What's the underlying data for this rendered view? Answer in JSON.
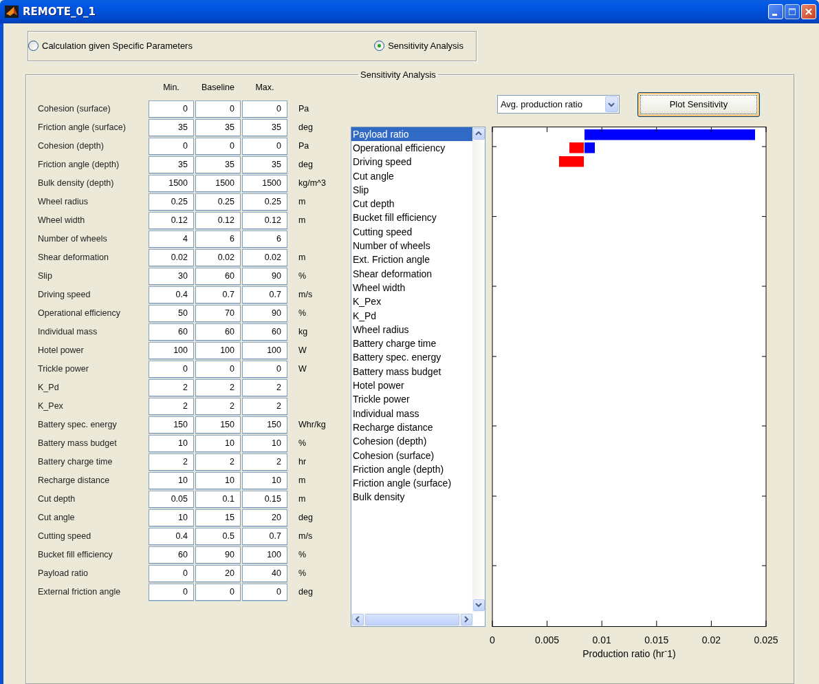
{
  "window": {
    "title": "REMOTE_0_1"
  },
  "mode_options": [
    {
      "label": "Calculation given Specific Parameters",
      "selected": false
    },
    {
      "label": "Sensitivity Analysis",
      "selected": true
    }
  ],
  "panel": {
    "title": "Sensitivity Analysis"
  },
  "parameters": {
    "columns": [
      "Min.",
      "Baseline",
      "Max."
    ],
    "rows": [
      {
        "label": "Cohesion (surface)",
        "min": "0",
        "baseline": "0",
        "max": "0",
        "unit": "Pa"
      },
      {
        "label": "Friction angle (surface)",
        "min": "35",
        "baseline": "35",
        "max": "35",
        "unit": "deg"
      },
      {
        "label": "Cohesion (depth)",
        "min": "0",
        "baseline": "0",
        "max": "0",
        "unit": "Pa"
      },
      {
        "label": "Friction angle (depth)",
        "min": "35",
        "baseline": "35",
        "max": "35",
        "unit": "deg"
      },
      {
        "label": "Bulk density (depth)",
        "min": "1500",
        "baseline": "1500",
        "max": "1500",
        "unit": "kg/m^3"
      },
      {
        "label": "Wheel radius",
        "min": "0.25",
        "baseline": "0.25",
        "max": "0.25",
        "unit": "m"
      },
      {
        "label": "Wheel width",
        "min": "0.12",
        "baseline": "0.12",
        "max": "0.12",
        "unit": "m"
      },
      {
        "label": "Number of wheels",
        "min": "4",
        "baseline": "6",
        "max": "6"
      },
      {
        "label": "Shear deformation",
        "min": "0.02",
        "baseline": "0.02",
        "max": "0.02",
        "unit": "m"
      },
      {
        "label": "Slip",
        "min": "30",
        "baseline": "60",
        "max": "90",
        "unit": "%"
      },
      {
        "label": "Driving speed",
        "min": "0.4",
        "baseline": "0.7",
        "max": "0.7",
        "unit": "m/s"
      },
      {
        "label": "Operational efficiency",
        "min": "50",
        "baseline": "70",
        "max": "90",
        "unit": "%"
      },
      {
        "label": "Individual mass",
        "min": "60",
        "baseline": "60",
        "max": "60",
        "unit": "kg"
      },
      {
        "label": "Hotel power",
        "min": "100",
        "baseline": "100",
        "max": "100",
        "unit": "W"
      },
      {
        "label": "Trickle power",
        "min": "0",
        "baseline": "0",
        "max": "0",
        "unit": "W"
      },
      {
        "label": "K_Pd",
        "min": "2",
        "baseline": "2",
        "max": "2"
      },
      {
        "label": "K_Pex",
        "min": "2",
        "baseline": "2",
        "max": "2"
      },
      {
        "label": "Battery spec. energy",
        "min": "150",
        "baseline": "150",
        "max": "150",
        "unit": "Whr/kg"
      },
      {
        "label": "Battery mass budget",
        "min": "10",
        "baseline": "10",
        "max": "10",
        "unit": "%"
      },
      {
        "label": "Battery charge time",
        "min": "2",
        "baseline": "2",
        "max": "2",
        "unit": "hr"
      },
      {
        "label": "Recharge distance",
        "min": "10",
        "baseline": "10",
        "max": "10",
        "unit": "m"
      },
      {
        "label": "Cut depth",
        "min": "0.05",
        "baseline": "0.1",
        "max": "0.15",
        "unit": "m"
      },
      {
        "label": "Cut angle",
        "min": "10",
        "baseline": "15",
        "max": "20",
        "unit": "deg"
      },
      {
        "label": "Cutting speed",
        "min": "0.4",
        "baseline": "0.5",
        "max": "0.7",
        "unit": "m/s"
      },
      {
        "label": "Bucket fill efficiency",
        "min": "60",
        "baseline": "90",
        "max": "100",
        "unit": "%"
      },
      {
        "label": "Payload ratio",
        "min": "0",
        "baseline": "20",
        "max": "40",
        "unit": "%"
      },
      {
        "label": "External friction angle",
        "min": "0",
        "baseline": "0",
        "max": "0",
        "unit": "deg"
      }
    ]
  },
  "output_select": {
    "value": "Avg. production ratio"
  },
  "plot_button": {
    "label": "Plot Sensitivity"
  },
  "sensitivity_list": {
    "items": [
      {
        "label": "Payload ratio",
        "selected": true
      },
      {
        "label": "Operational efficiency",
        "selected": false
      },
      {
        "label": "Driving speed",
        "selected": false
      },
      {
        "label": "Cut angle",
        "selected": false
      },
      {
        "label": "Slip",
        "selected": false
      },
      {
        "label": "Cut depth",
        "selected": false
      },
      {
        "label": "Bucket fill efficiency",
        "selected": false
      },
      {
        "label": "Cutting speed",
        "selected": false
      },
      {
        "label": "Number of wheels",
        "selected": false
      },
      {
        "label": "Ext. Friction angle",
        "selected": false
      },
      {
        "label": "Shear deformation",
        "selected": false
      },
      {
        "label": "Wheel width",
        "selected": false
      },
      {
        "label": "K_Pex",
        "selected": false
      },
      {
        "label": "K_Pd",
        "selected": false
      },
      {
        "label": "Wheel radius",
        "selected": false
      },
      {
        "label": "Battery charge time",
        "selected": false
      },
      {
        "label": "Battery spec. energy",
        "selected": false
      },
      {
        "label": "Battery mass budget",
        "selected": false
      },
      {
        "label": "Hotel power",
        "selected": false
      },
      {
        "label": "Trickle power",
        "selected": false
      },
      {
        "label": "Individual mass",
        "selected": false
      },
      {
        "label": "Recharge distance",
        "selected": false
      },
      {
        "label": "Cohesion (depth)",
        "selected": false
      },
      {
        "label": "Cohesion (surface)",
        "selected": false
      },
      {
        "label": "Friction angle (depth)",
        "selected": false
      },
      {
        "label": "Friction angle (surface)",
        "selected": false
      },
      {
        "label": "Bulk density",
        "selected": false
      }
    ]
  },
  "chart": {
    "x_tick_labels": [
      "0",
      "0.005",
      "0.01",
      "0.015",
      "0.02",
      "0.025"
    ],
    "x_axis_title": "Production ratio (hr$^{-}$1)"
  }
}
